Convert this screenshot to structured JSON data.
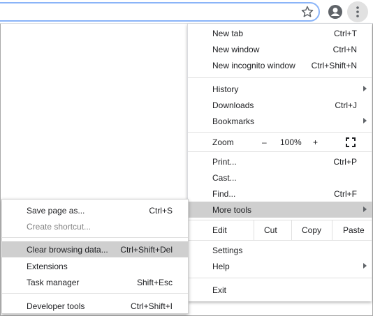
{
  "menu": {
    "new_tab": {
      "label": "New tab",
      "shortcut": "Ctrl+T"
    },
    "new_window": {
      "label": "New window",
      "shortcut": "Ctrl+N"
    },
    "new_incognito": {
      "label": "New incognito window",
      "shortcut": "Ctrl+Shift+N"
    },
    "history": {
      "label": "History"
    },
    "downloads": {
      "label": "Downloads",
      "shortcut": "Ctrl+J"
    },
    "bookmarks": {
      "label": "Bookmarks"
    },
    "zoom": {
      "label": "Zoom",
      "minus": "–",
      "level": "100%",
      "plus": "+"
    },
    "print": {
      "label": "Print...",
      "shortcut": "Ctrl+P"
    },
    "cast": {
      "label": "Cast..."
    },
    "find": {
      "label": "Find...",
      "shortcut": "Ctrl+F"
    },
    "more_tools": {
      "label": "More tools"
    },
    "edit": {
      "label": "Edit",
      "cut": "Cut",
      "copy": "Copy",
      "paste": "Paste"
    },
    "settings": {
      "label": "Settings"
    },
    "help": {
      "label": "Help"
    },
    "exit": {
      "label": "Exit"
    }
  },
  "submenu": {
    "save_page": {
      "label": "Save page as...",
      "shortcut": "Ctrl+S"
    },
    "create_shortcut": {
      "label": "Create shortcut..."
    },
    "clear_data": {
      "label": "Clear browsing data...",
      "shortcut": "Ctrl+Shift+Del"
    },
    "extensions": {
      "label": "Extensions"
    },
    "task_manager": {
      "label": "Task manager",
      "shortcut": "Shift+Esc"
    },
    "dev_tools": {
      "label": "Developer tools",
      "shortcut": "Ctrl+Shift+I"
    }
  },
  "colors": {
    "highlight": "#cfcfcf",
    "omnibox_border": "#8ab4f8",
    "icon": "#5f6368"
  }
}
